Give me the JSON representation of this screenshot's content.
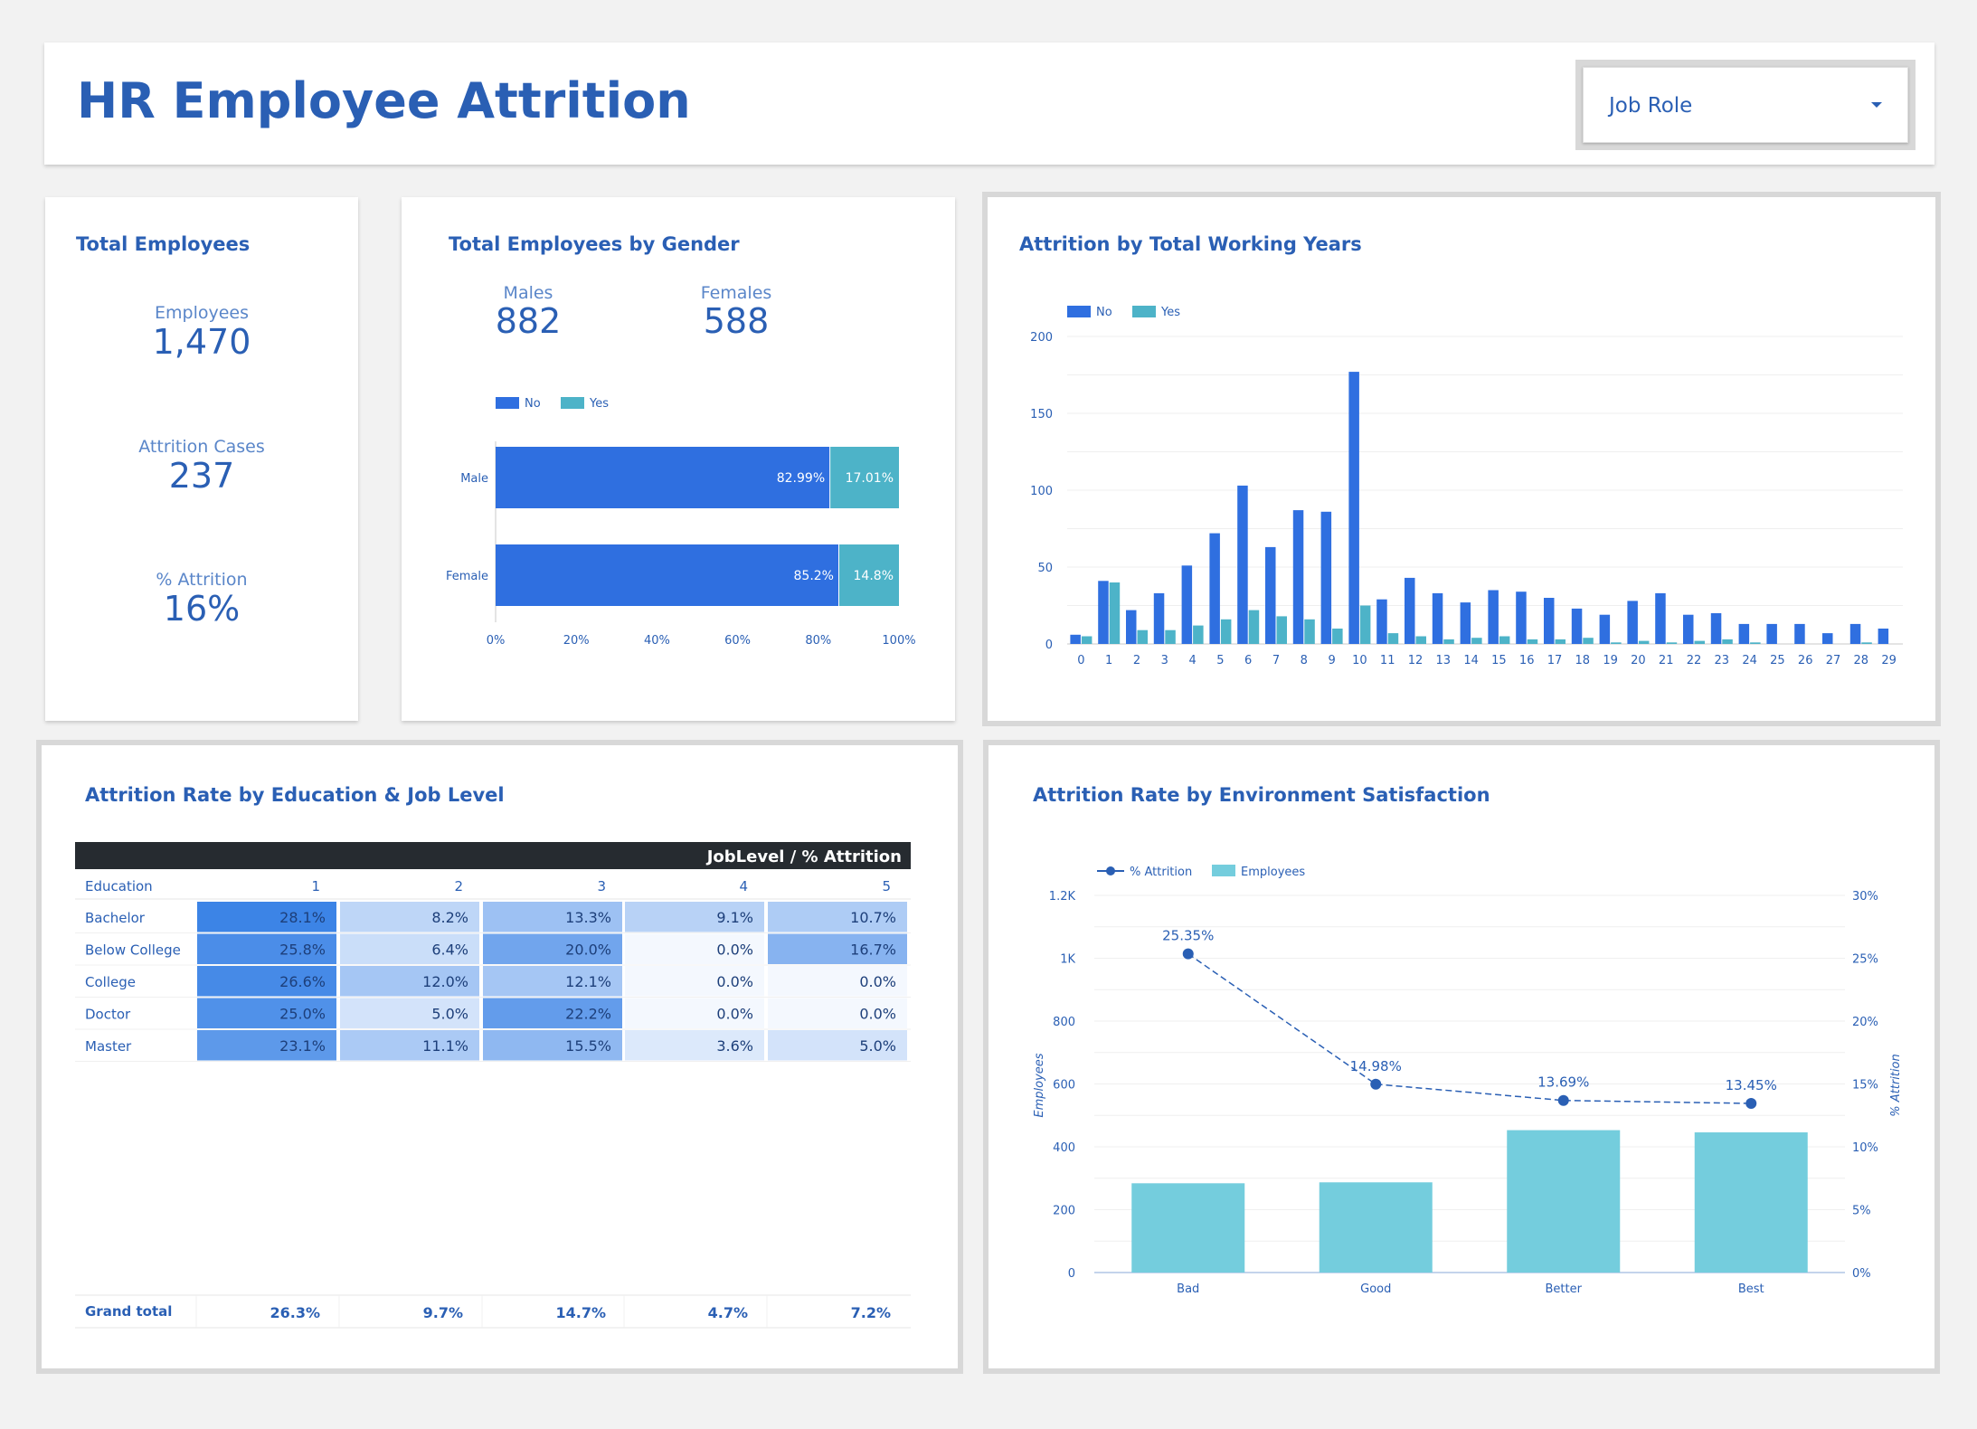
{
  "header": {
    "title": "HR Employee Attrition",
    "dropdown_label": "Job Role"
  },
  "total_card": {
    "title": "Total Employees",
    "kpis": [
      {
        "label": "Employees",
        "value": "1,470"
      },
      {
        "label": "Attrition Cases",
        "value": "237"
      },
      {
        "label": "% Attrition",
        "value": "16%"
      }
    ]
  },
  "gender_card": {
    "title": "Total Employees by Gender",
    "kpis": [
      {
        "label": "Males",
        "value": "882"
      },
      {
        "label": "Females",
        "value": "588"
      }
    ]
  },
  "working_years_card": {
    "title": "Attrition by Total Working Years"
  },
  "education_card": {
    "title": "Attrition Rate by Education & Job Level",
    "header_banner": "JobLevel / % Attrition",
    "row_header": "Education",
    "columns": [
      "1",
      "2",
      "3",
      "4",
      "5"
    ],
    "rows": [
      {
        "label": "Bachelor",
        "cells": [
          "28.1%",
          "8.2%",
          "13.3%",
          "9.1%",
          "10.7%"
        ],
        "levels": [
          0.281,
          0.082,
          0.133,
          0.091,
          0.107
        ]
      },
      {
        "label": "Below College",
        "cells": [
          "25.8%",
          "6.4%",
          "20.0%",
          "0.0%",
          "16.7%"
        ],
        "levels": [
          0.258,
          0.064,
          0.2,
          0.0,
          0.167
        ]
      },
      {
        "label": "College",
        "cells": [
          "26.6%",
          "12.0%",
          "12.1%",
          "0.0%",
          "0.0%"
        ],
        "levels": [
          0.266,
          0.12,
          0.121,
          0.0,
          0.0
        ]
      },
      {
        "label": "Doctor",
        "cells": [
          "25.0%",
          "5.0%",
          "22.2%",
          "0.0%",
          "0.0%"
        ],
        "levels": [
          0.25,
          0.05,
          0.222,
          0.0,
          0.0
        ]
      },
      {
        "label": "Master",
        "cells": [
          "23.1%",
          "11.1%",
          "15.5%",
          "3.6%",
          "5.0%"
        ],
        "levels": [
          0.231,
          0.111,
          0.155,
          0.036,
          0.05
        ]
      }
    ],
    "total_label": "Grand total",
    "totals": [
      "26.3%",
      "9.7%",
      "14.7%",
      "4.7%",
      "7.2%"
    ]
  },
  "environment_card": {
    "title": "Attrition Rate by Environment Satisfaction"
  },
  "colors": {
    "no": "#2f6fe0",
    "yes": "#4db3c8",
    "bar": "#74cddd",
    "line": "#2a5fb4",
    "banner": "#262b30"
  },
  "chart_data": [
    {
      "type": "bar",
      "orientation": "horizontal",
      "stacked": true,
      "categories": [
        "Male",
        "Female"
      ],
      "series": [
        {
          "name": "No",
          "values": [
            82.99,
            85.2
          ],
          "labels": [
            "82.99%",
            "85.2%"
          ]
        },
        {
          "name": "Yes",
          "values": [
            17.01,
            14.8
          ],
          "labels": [
            "17.01%",
            "14.8%"
          ]
        }
      ],
      "xticks": [
        "0%",
        "20%",
        "40%",
        "60%",
        "80%",
        "100%"
      ],
      "xlim": [
        0,
        100
      ],
      "legend": "top-left"
    },
    {
      "type": "bar",
      "categories": [
        "0",
        "1",
        "2",
        "3",
        "4",
        "5",
        "6",
        "7",
        "8",
        "9",
        "10",
        "11",
        "12",
        "13",
        "14",
        "15",
        "16",
        "17",
        "18",
        "19",
        "20",
        "21",
        "22",
        "23",
        "24",
        "25",
        "26",
        "27",
        "28",
        "29"
      ],
      "series": [
        {
          "name": "No",
          "values": [
            6,
            41,
            22,
            33,
            51,
            72,
            103,
            63,
            87,
            86,
            177,
            29,
            43,
            33,
            27,
            35,
            34,
            30,
            23,
            19,
            28,
            33,
            19,
            20,
            13,
            13,
            13,
            7,
            13,
            10
          ]
        },
        {
          "name": "Yes",
          "values": [
            5,
            40,
            9,
            9,
            12,
            16,
            22,
            18,
            16,
            10,
            25,
            7,
            5,
            3,
            4,
            5,
            3,
            3,
            4,
            1,
            2,
            1,
            2,
            3,
            1,
            0,
            0,
            0,
            1,
            0
          ]
        }
      ],
      "ylim": [
        0,
        200
      ],
      "yticks": [
        "0",
        "50",
        "100",
        "150",
        "200"
      ],
      "legend": "top-left"
    },
    {
      "type": "bar",
      "combo_line": true,
      "categories": [
        "Bad",
        "Good",
        "Better",
        "Best"
      ],
      "series": [
        {
          "name": "Employees",
          "values": [
            284,
            287,
            453,
            446
          ],
          "axis": "left"
        },
        {
          "name": "% Attrition",
          "values": [
            25.35,
            14.98,
            13.69,
            13.45
          ],
          "labels": [
            "25.35%",
            "14.98%",
            "13.69%",
            "13.45%"
          ],
          "axis": "right"
        }
      ],
      "ylabel": "Employees",
      "y2label": "% Attrition",
      "ylim": [
        0,
        1200
      ],
      "y2lim": [
        0,
        30
      ],
      "yticks": [
        "0",
        "200",
        "400",
        "600",
        "800",
        "1K",
        "1.2K"
      ],
      "y2ticks": [
        "0%",
        "5%",
        "10%",
        "15%",
        "20%",
        "25%",
        "30%"
      ],
      "legend": "top-left"
    }
  ]
}
